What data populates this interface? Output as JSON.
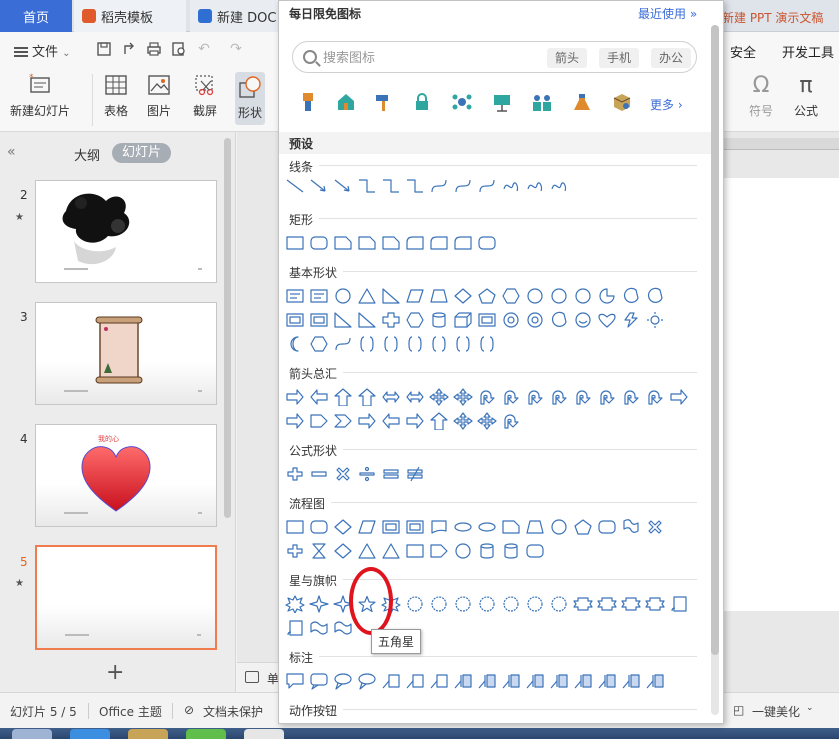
{
  "tabs": {
    "home": "首页",
    "template": "稻壳模板",
    "doc": "新建 DOC",
    "ppt": "新建 PPT 演示文稿"
  },
  "menubar": {
    "file": "文件",
    "security": "安全",
    "devtools": "开发工具"
  },
  "ribbon": {
    "new_slide": "新建幻灯片",
    "table": "表格",
    "image": "图片",
    "screenshot": "截屏",
    "shape": "形状",
    "symbol": "符号",
    "formula": "公式"
  },
  "leftpanel": {
    "outline": "大纲",
    "slides": "幻灯片",
    "slide_numbers": [
      "2",
      "3",
      "4",
      "5"
    ],
    "heart_caption": "我的心"
  },
  "panel": {
    "title": "每日限免图标",
    "recent": "最近使用",
    "search_placeholder": "搜索图标",
    "chips": [
      "箭头",
      "手机",
      "办公"
    ],
    "more": "更多",
    "preset": "预设",
    "categories": {
      "lines": "线条",
      "rect": "矩形",
      "basic": "基本形状",
      "arrows": "箭头总汇",
      "equation": "公式形状",
      "flowchart": "流程图",
      "stars": "星与旗帜",
      "callouts": "标注",
      "actions": "动作按钮"
    },
    "tooltip": "五角星"
  },
  "notes": {
    "label": "单"
  },
  "statusbar": {
    "slide_count": "幻灯片 5 / 5",
    "theme": "Office 主题",
    "protection": "文档未保护",
    "beautify": "一键美化"
  },
  "colors": {
    "accent": "#3b6dd6",
    "selected_slide": "#f07b4e",
    "highlight_ring": "#e0141e",
    "shape_stroke": "#3b73b9"
  }
}
